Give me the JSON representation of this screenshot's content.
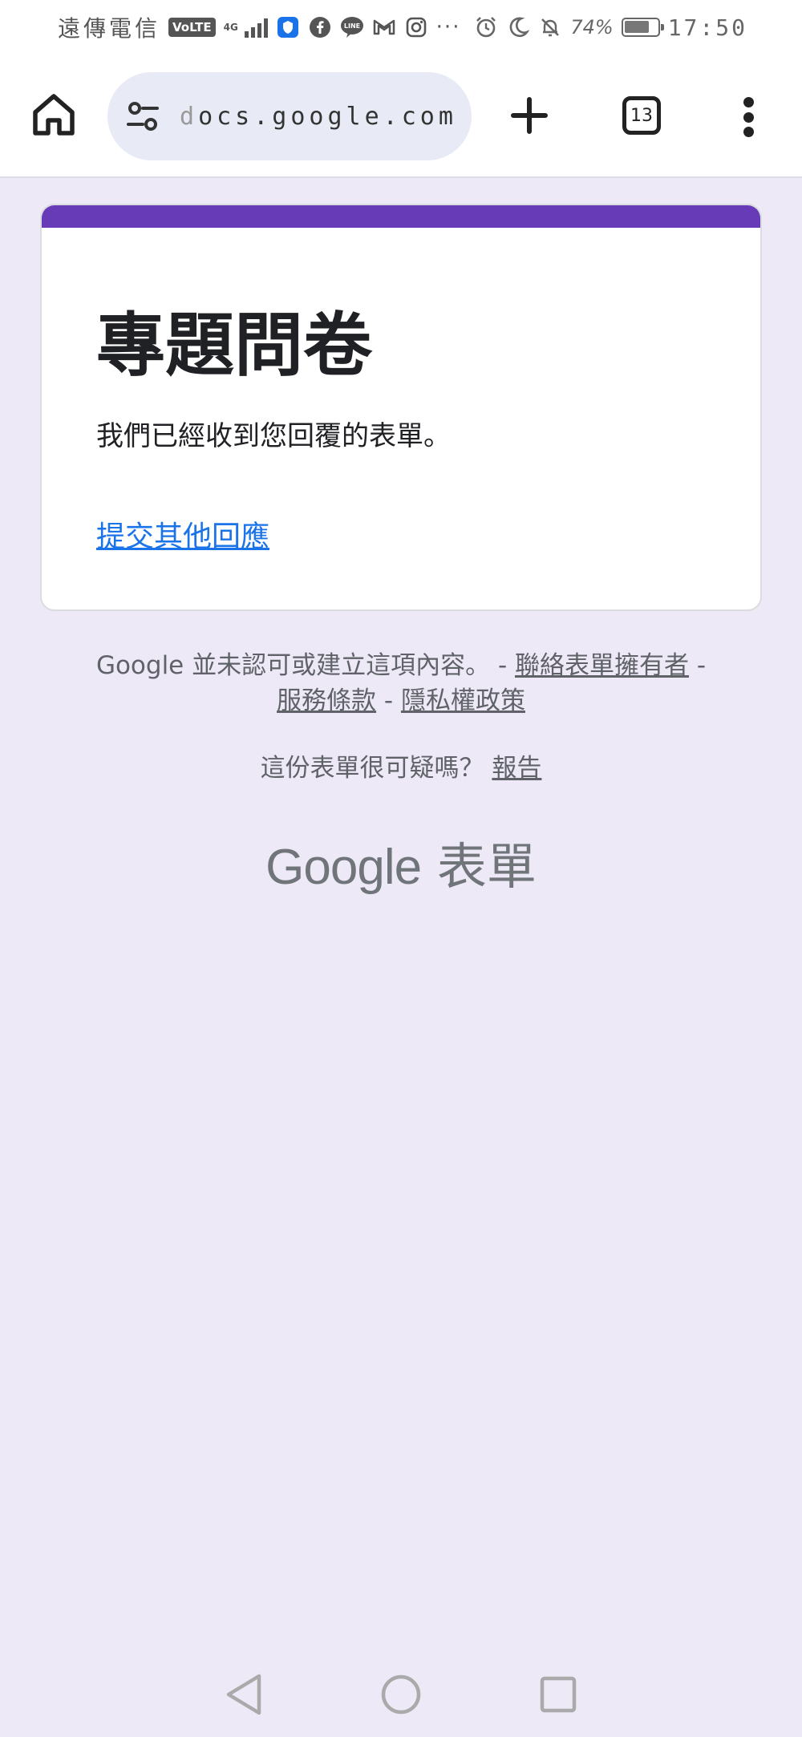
{
  "status_bar": {
    "carrier": "遠傳電信",
    "volte": "VoLTE",
    "network": "4G",
    "more": "···",
    "battery_percent": "74%",
    "time": "17:50",
    "battery_level": 0.74
  },
  "browser": {
    "url": "docs.google.com",
    "tab_count": "13"
  },
  "form": {
    "accent_color": "#673ab7",
    "title": "專題問卷",
    "message": "我們已經收到您回覆的表單。",
    "another_response_link": "提交其他回應"
  },
  "footer": {
    "disclaimer": "Google 並未認可或建立這項內容。",
    "sep1": " - ",
    "contact_owner": "聯絡表單擁有者",
    "sep2": " -",
    "terms": "服務條款",
    "sep3": " - ",
    "privacy": "隱私權政策",
    "suspicious": "這份表單很可疑嗎？",
    "report": "報告"
  },
  "brand": {
    "google": "Google",
    "product": "表單"
  }
}
